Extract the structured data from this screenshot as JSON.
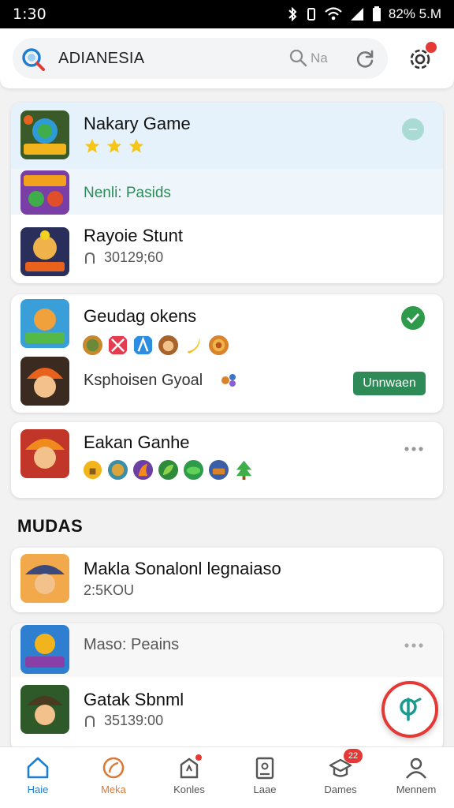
{
  "status": {
    "time": "1:30",
    "right": "82% 5.M"
  },
  "search": {
    "query": "ADIANESIA",
    "hint": "Na"
  },
  "colors": {
    "accent": "#1e7fd1",
    "green": "#2e8b57",
    "red": "#e53935"
  },
  "cards": [
    {
      "rows": [
        {
          "title": "Nakary Game",
          "rating_stars": 3
        },
        {
          "subtitle": "Nenli: Pasids"
        },
        {
          "title": "Rayoie Stunt",
          "subtitle": "30129;60"
        }
      ]
    },
    {
      "rows": [
        {
          "title": "Geudag okens",
          "emojis": [
            "coin",
            "gift",
            "ticket",
            "face",
            "banana",
            "shield"
          ]
        },
        {
          "title": "Ksphoisen Gyoal",
          "button": "Unnwaen"
        }
      ]
    },
    {
      "rows": [
        {
          "title": "Eakan Ganhe",
          "emojis": [
            "lock",
            "egg",
            "flame",
            "leaf",
            "melon",
            "basket",
            "tree"
          ]
        }
      ]
    }
  ],
  "section": {
    "title": "MUDAS"
  },
  "section_cards": [
    {
      "rows": [
        {
          "title": "Makla Sonalonl legnaiaso",
          "subtitle": "2:5KOU"
        }
      ]
    },
    {
      "rows": [
        {
          "title": "Maso: Peains"
        },
        {
          "title": "Gatak Sbnml",
          "subtitle": "35139:00"
        }
      ]
    }
  ],
  "nav": [
    {
      "label": "Haie",
      "icon": "home-icon",
      "active": true
    },
    {
      "label": "Meka",
      "icon": "leaf-icon"
    },
    {
      "label": "Konles",
      "icon": "bag-icon",
      "dot": true
    },
    {
      "label": "Laae",
      "icon": "tablet-icon"
    },
    {
      "label": "Dames",
      "icon": "cap-icon",
      "badge": "22"
    },
    {
      "label": "Mennem",
      "icon": "person-icon"
    }
  ]
}
